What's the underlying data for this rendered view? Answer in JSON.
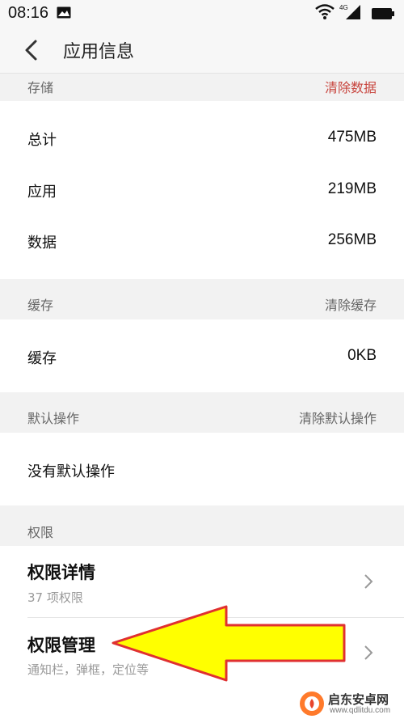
{
  "status_bar": {
    "time": "08:16",
    "network": "4G"
  },
  "app_bar": {
    "title": "应用信息"
  },
  "storage": {
    "header": "存储",
    "action": "清除数据",
    "rows": [
      {
        "label": "总计",
        "value": "475MB"
      },
      {
        "label": "应用",
        "value": "219MB"
      },
      {
        "label": "数据",
        "value": "256MB"
      }
    ]
  },
  "cache": {
    "header": "缓存",
    "action": "清除缓存",
    "rows": [
      {
        "label": "缓存",
        "value": "0KB"
      }
    ]
  },
  "default_ops": {
    "header": "默认操作",
    "action": "清除默认操作",
    "text": "没有默认操作"
  },
  "permissions": {
    "header": "权限",
    "items": [
      {
        "title": "权限详情",
        "subtitle": "37 项权限"
      },
      {
        "title": "权限管理",
        "subtitle": "通知栏，弹框，定位等"
      }
    ]
  },
  "watermark": {
    "name": "启东安卓网",
    "url": "www.qdlitdu.com"
  },
  "colors": {
    "danger": "#c8453e",
    "arrow_fill": "#ffff00",
    "arrow_stroke": "#e03030"
  }
}
